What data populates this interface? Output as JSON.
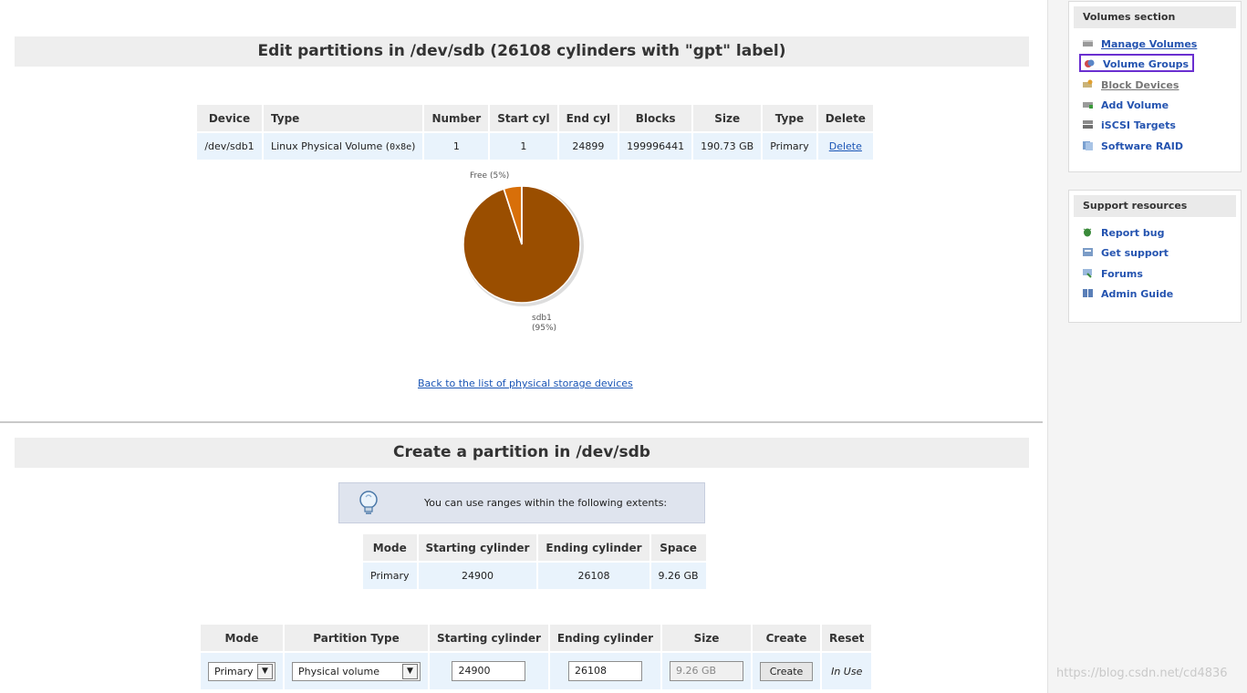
{
  "edit": {
    "title": "Edit partitions in /dev/sdb (26108 cylinders with \"gpt\" label)",
    "columns": [
      "Device",
      "Type",
      "Number",
      "Start cyl",
      "End cyl",
      "Blocks",
      "Size",
      "Type",
      "Delete"
    ],
    "row": {
      "device": "/dev/sdb1",
      "type_text": "Linux Physical Volume (",
      "type_code": "0x8e",
      "type_close": ")",
      "number": "1",
      "start_cyl": "1",
      "end_cyl": "24899",
      "blocks": "199996441",
      "size": "190.73 GB",
      "ptype": "Primary",
      "delete": "Delete"
    },
    "pie": {
      "free_label": "Free (5%)",
      "used_label": "sdb1",
      "used_pct": "(95%)",
      "used_fraction": 0.95,
      "used_color": "#9a4e00",
      "free_color": "#d86f09"
    },
    "back_link": "Back to the list of physical storage devices"
  },
  "create": {
    "title": "Create a partition in /dev/sdb",
    "hint": "You can use ranges within the following extents:",
    "extents_columns": [
      "Mode",
      "Starting cylinder",
      "Ending cylinder",
      "Space"
    ],
    "extents_row": {
      "mode": "Primary",
      "start": "24900",
      "end": "26108",
      "space": "9.26 GB"
    },
    "form_columns": [
      "Mode",
      "Partition Type",
      "Starting cylinder",
      "Ending cylinder",
      "Size",
      "Create",
      "Reset"
    ],
    "form": {
      "mode": "Primary",
      "partition_type": "Physical volume",
      "start": "24900",
      "end": "26108",
      "size": "9.26 GB",
      "create_label": "Create",
      "reset_label": "In Use"
    }
  },
  "sidebar": {
    "volumes_title": "Volumes section",
    "volumes_items": [
      {
        "label": "Manage Volumes",
        "icon": "disk-icon"
      },
      {
        "label": "Volume Groups",
        "icon": "group-icon"
      },
      {
        "label": "Block Devices",
        "icon": "block-icon"
      },
      {
        "label": "Add Volume",
        "icon": "add-icon"
      },
      {
        "label": "iSCSI Targets",
        "icon": "server-icon"
      },
      {
        "label": "Software RAID",
        "icon": "raid-icon"
      }
    ],
    "support_title": "Support resources",
    "support_items": [
      {
        "label": "Report bug",
        "icon": "bug-icon"
      },
      {
        "label": "Get support",
        "icon": "support-icon"
      },
      {
        "label": "Forums",
        "icon": "forum-icon"
      },
      {
        "label": "Admin Guide",
        "icon": "book-icon"
      }
    ]
  },
  "watermark": "https://blog.csdn.net/cd4836"
}
